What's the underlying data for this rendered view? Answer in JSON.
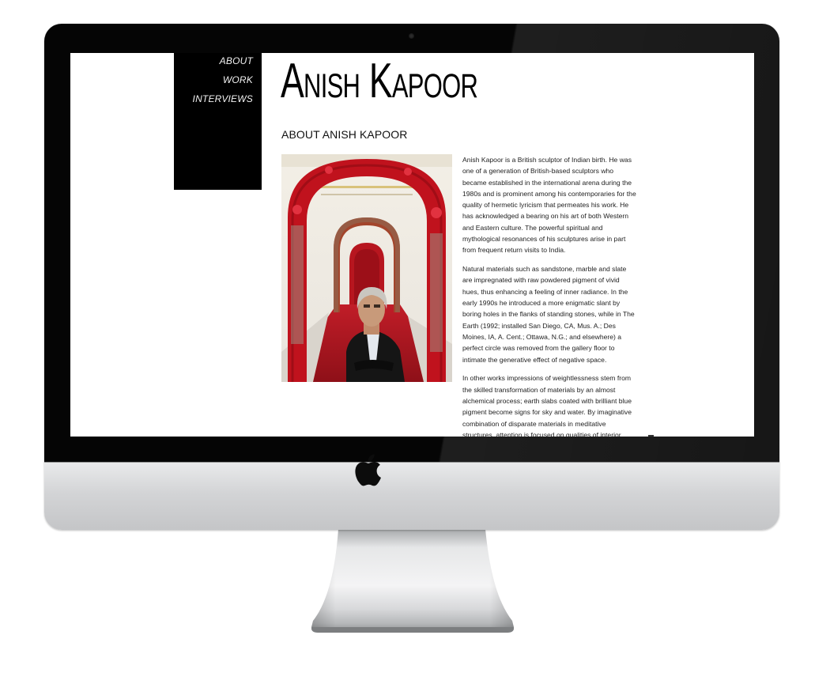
{
  "site": {
    "title": "Anish Kapoor",
    "nav": [
      {
        "label": "ABOUT"
      },
      {
        "label": "WORK"
      },
      {
        "label": "INTERVIEWS"
      }
    ]
  },
  "main": {
    "heading": "ABOUT ANISH KAPOOR",
    "paragraphs": [
      "Anish Kapoor is a British sculptor of Indian birth. He was one of a generation of British-based sculptors who became established in the international arena during the 1980s and is prominent among his contemporaries for the quality of hermetic lyricism that permeates his work. He has acknowledged a bearing on his art of both Western and Eastern culture. The powerful spiritual and mythological resonances of his sculptures arise in part from frequent return visits to India.",
      "Natural materials such as sandstone, marble and slate are impregnated with raw powdered pigment of vivid hues, thus enhancing a feeling of inner radiance. In the early 1990s he introduced a more enigmatic slant by boring holes in the flanks of standing stones, while in The Earth (1992; installed San Diego, CA, Mus. A.; Des Moines, IA, A. Cent.; Ottawa, N.G.; and elsewhere) a perfect circle was removed from the gallery floor to intimate the generative effect of negative space.",
      "In other works impressions of weightlessness stem from the skilled transformation of materials by an almost alchemical process; earth slabs coated with brilliant blue pigment become signs for sky and water. By imaginative combination of disparate materials in meditative structures, attention is focused on qualities of interior"
    ]
  },
  "device": {
    "logo": "apple-logo-icon"
  },
  "colors": {
    "nav_bg": "#000000",
    "nav_text": "#f2f2f2",
    "accent_red": "#b3141c"
  }
}
